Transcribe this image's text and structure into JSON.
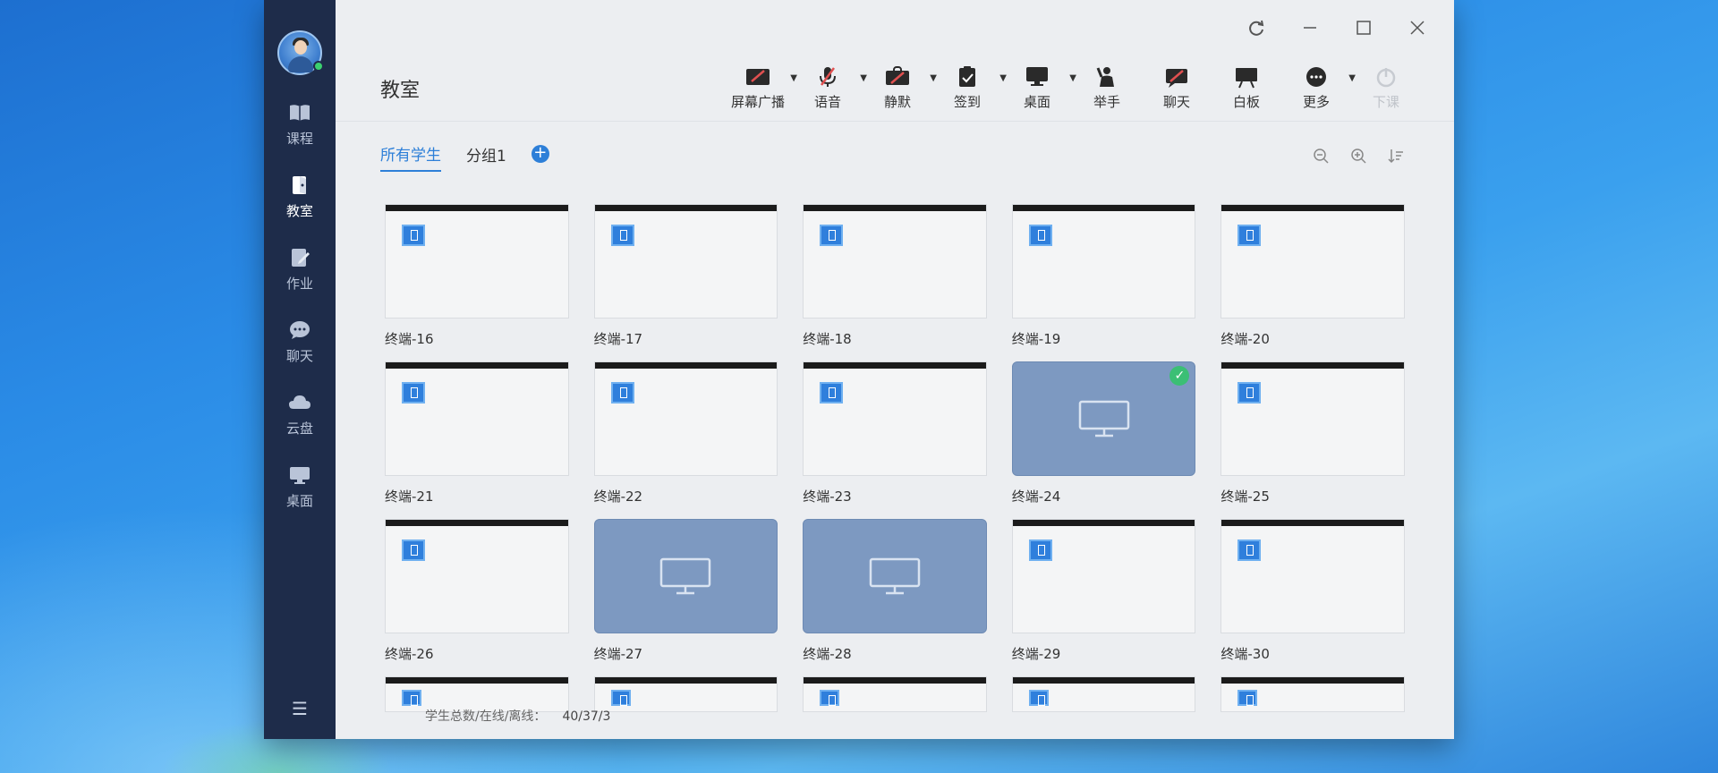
{
  "sidebar": {
    "items": [
      {
        "label": "课程",
        "icon": "book-icon"
      },
      {
        "label": "教室",
        "icon": "classroom-icon"
      },
      {
        "label": "作业",
        "icon": "homework-icon"
      },
      {
        "label": "聊天",
        "icon": "chat-icon"
      },
      {
        "label": "云盘",
        "icon": "cloud-icon"
      },
      {
        "label": "桌面",
        "icon": "desktop-icon"
      }
    ],
    "active": "教室"
  },
  "header": {
    "title": "教室"
  },
  "toolbar": {
    "items": [
      {
        "label": "屏幕广播",
        "icon": "screen-broadcast-icon",
        "has_dropdown": true
      },
      {
        "label": "语音",
        "icon": "voice-icon",
        "has_dropdown": true
      },
      {
        "label": "静默",
        "icon": "silence-icon",
        "has_dropdown": true
      },
      {
        "label": "签到",
        "icon": "sign-in-icon",
        "has_dropdown": true
      },
      {
        "label": "桌面",
        "icon": "desktop-icon",
        "has_dropdown": true
      },
      {
        "label": "举手",
        "icon": "raise-hand-icon",
        "has_dropdown": false
      },
      {
        "label": "聊天",
        "icon": "chat-off-icon",
        "has_dropdown": false
      },
      {
        "label": "白板",
        "icon": "whiteboard-icon",
        "has_dropdown": false
      },
      {
        "label": "更多",
        "icon": "more-icon",
        "has_dropdown": true
      },
      {
        "label": "下课",
        "icon": "end-class-icon",
        "has_dropdown": false,
        "disabled": true
      }
    ]
  },
  "tabs": {
    "items": [
      "所有学生",
      "分组1"
    ],
    "active": "所有学生"
  },
  "terminals": [
    {
      "name": "终端-16",
      "state": "online"
    },
    {
      "name": "终端-17",
      "state": "online"
    },
    {
      "name": "终端-18",
      "state": "online"
    },
    {
      "name": "终端-19",
      "state": "online"
    },
    {
      "name": "终端-20",
      "state": "online"
    },
    {
      "name": "终端-21",
      "state": "online"
    },
    {
      "name": "终端-22",
      "state": "online"
    },
    {
      "name": "终端-23",
      "state": "online"
    },
    {
      "name": "终端-24",
      "state": "offline",
      "selected": true
    },
    {
      "name": "终端-25",
      "state": "online"
    },
    {
      "name": "终端-26",
      "state": "online"
    },
    {
      "name": "终端-27",
      "state": "offline"
    },
    {
      "name": "终端-28",
      "state": "offline"
    },
    {
      "name": "终端-29",
      "state": "online"
    },
    {
      "name": "终端-30",
      "state": "online"
    }
  ],
  "partial_row_count": 5,
  "status": {
    "label": "学生总数/在线/离线：",
    "value": "40/37/3"
  },
  "colors": {
    "sidebar_bg": "#1e2c4a",
    "accent": "#2d7fd8",
    "offline_thumb": "#7d99c1",
    "selected_badge": "#3bbf75"
  }
}
